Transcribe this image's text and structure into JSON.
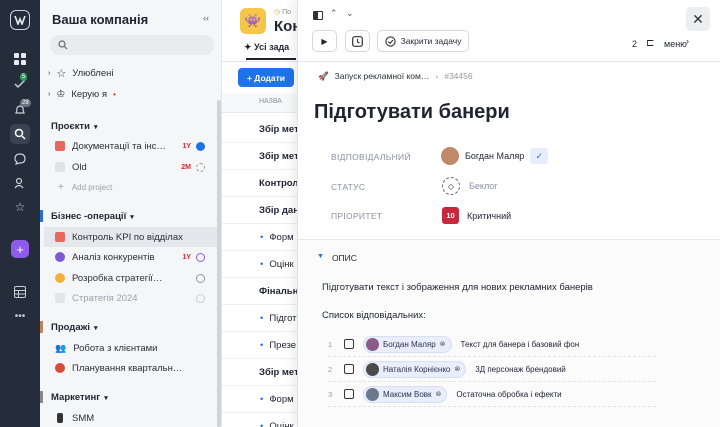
{
  "sidebar": {
    "workspace": "Ваша компанія",
    "favorites": "Улюблені",
    "managed": "Керую я",
    "projects": {
      "title": "Проєкти",
      "items": [
        {
          "label": "Документації та інс…",
          "tag": "1Y"
        },
        {
          "label": "Old",
          "tag": "2M"
        }
      ],
      "add": "Add project"
    },
    "biz": {
      "title": "Бізнес -операції",
      "items": [
        {
          "label": "Контроль KPI по відділах",
          "tag": ""
        },
        {
          "label": "Аналіз конкурентів",
          "tag": "1Y"
        },
        {
          "label": "Розробка стратегії…",
          "tag": ""
        },
        {
          "label": "Стратегія 2024",
          "tag": ""
        }
      ]
    },
    "sales": {
      "title": "Продажі",
      "items": [
        {
          "label": "Робота з клієнтами"
        },
        {
          "label": "Планування квартальн…"
        }
      ]
    },
    "marketing": {
      "title": "Маркетинг",
      "items": [
        {
          "label": "SMM"
        }
      ]
    }
  },
  "rail": {
    "badge_check": "5",
    "badge_bell": "28"
  },
  "main": {
    "crumb": "По",
    "title": "Конт",
    "tab": "Усі зада",
    "add": "+ Додати",
    "col": "НАЗВА",
    "rows": [
      "Збір мет",
      "Збір мет",
      "Контрол",
      "Збір дан",
      "Форм",
      "Оцінк",
      "Фінальн",
      "Підгот",
      "Презе",
      "Збір мет",
      "Форм",
      "Оцінк"
    ]
  },
  "task": {
    "close_label": "Закрити задачу",
    "counter": "2",
    "menu": "меню",
    "project": "Запуск рекламної ком…",
    "id": "#34456",
    "title": "Підготувати банери",
    "labels": {
      "owner": "ВІДПОВІДАЛЬНИЙ",
      "status": "СТАТУС",
      "priority": "ПРІОРИТЕТ"
    },
    "owner": "Богдан Маляр",
    "status": "Беклог",
    "priority_num": "10",
    "priority": "Критичний",
    "desc_title": "ОПИС",
    "desc_text": "Підготувати текст і зображення для нових рекламних банерів",
    "list_title": "Список відповідальних:",
    "table": [
      {
        "n": "1",
        "name": "Богдан Маляр",
        "text": "Текст для банера і базовий фон"
      },
      {
        "n": "2",
        "name": "Наталія Корнієнко",
        "text": "3Д персонаж брендовий"
      },
      {
        "n": "3",
        "name": "Максим Вовк",
        "text": "Остаточна обробка і ефекти"
      }
    ]
  },
  "colors": {
    "accent": "#1f73e8",
    "critical": "#c8283b",
    "rail": "#262d3a"
  }
}
